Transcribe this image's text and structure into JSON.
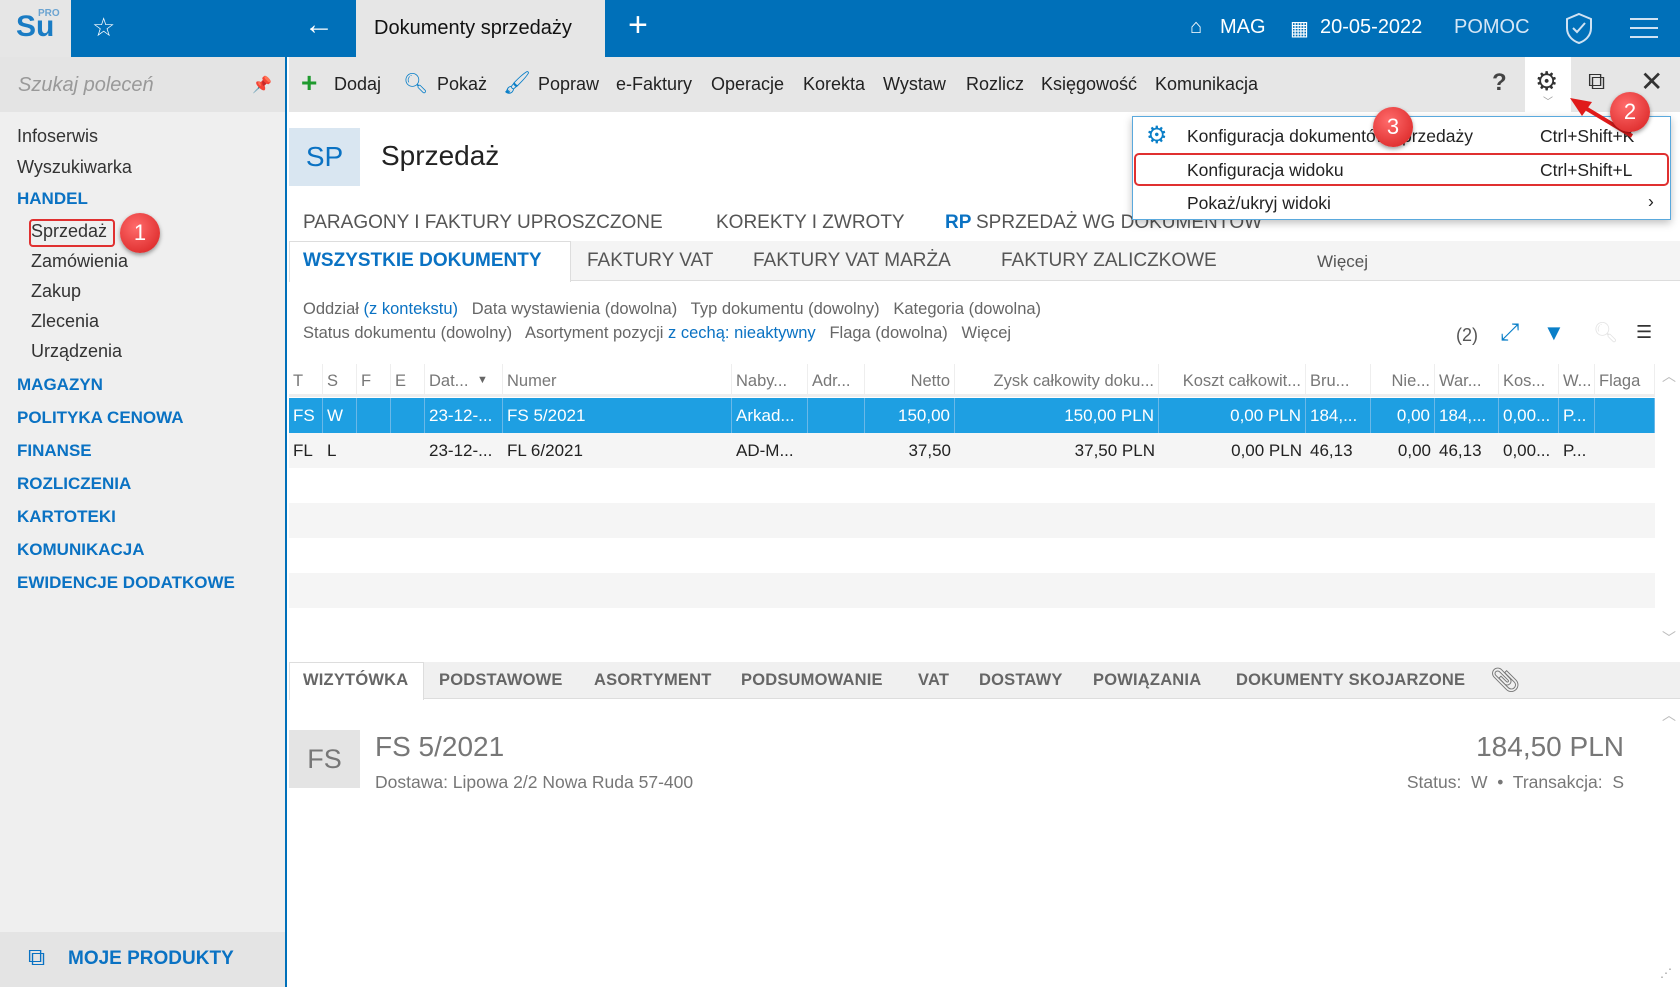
{
  "topbar": {
    "logo": "Su",
    "logo_sup": "PRO",
    "tab_title": "Dokumenty sprzedaży",
    "warehouse": "MAG",
    "date": "20-05-2022",
    "help": "POMOC"
  },
  "sidebar": {
    "search_placeholder": "Szukaj poleceń",
    "items": [
      "Infoserwis",
      "Wyszukiwarka"
    ],
    "handel": "HANDEL",
    "handel_items": [
      "Sprzedaż",
      "Zamówienia",
      "Zakup",
      "Zlecenia",
      "Urządzenia"
    ],
    "sections": [
      "MAGAZYN",
      "POLITYKA CENOWA",
      "FINANSE",
      "ROZLICZENIA",
      "KARTOTEKI",
      "KOMUNIKACJA",
      "EWIDENCJE DODATKOWE"
    ],
    "footer": "MOJE PRODUKTY"
  },
  "toolbar": {
    "items": [
      "Dodaj",
      "Pokaż",
      "Popraw",
      "e-Faktury",
      "Operacje",
      "Korekta",
      "Wystaw",
      "Rozlicz",
      "Księgowość",
      "Komunikacja"
    ],
    "help": "?"
  },
  "header": {
    "code": "SP",
    "title": "Sprzedaż"
  },
  "tabs_top": [
    "PARAGONY I FAKTURY UPROSZCZONE",
    "KOREKTY I ZWROTY",
    "RP",
    "SPRZEDAŻ WG DOKUMENTÓW"
  ],
  "tabs": [
    "WSZYSTKIE DOKUMENTY",
    "FAKTURY VAT",
    "FAKTURY VAT MARŻA",
    "FAKTURY ZALICZKOWE",
    "Więcej"
  ],
  "filters": {
    "oddzial": "Oddział",
    "oddzial_val": "(z kontekstu)",
    "data": "Data wystawienia (dowolna)",
    "typ": "Typ dokumentu (dowolny)",
    "kategoria": "Kategoria (dowolna)",
    "status": "Status dokumentu (dowolny)",
    "asort": "Asortyment pozycji",
    "asort_val": "z cechą: nieaktywny",
    "flaga": "Flaga (dowolna)",
    "wiecej": "Więcej",
    "count": "(2)"
  },
  "grid": {
    "columns": [
      "T",
      "S",
      "F",
      "E",
      "Dat...",
      "Numer",
      "Naby...",
      "Adr...",
      "Netto",
      "Zysk całkowity doku...",
      "Koszt całkowit...",
      "Bru...",
      "Nie...",
      "War...",
      "Kos...",
      "W...",
      "Flaga"
    ],
    "rows": [
      [
        "FS",
        "W",
        "",
        "",
        "23-12-...",
        "FS 5/2021",
        "Arkad...",
        "",
        "150,00",
        "150,00 PLN",
        "0,00 PLN",
        "184,...",
        "0,00",
        "184,...",
        "0,00...",
        "P...",
        ""
      ],
      [
        "FL",
        "L",
        "",
        "",
        "23-12-...",
        "FL 6/2021",
        "AD-M...",
        "",
        "37,50",
        "37,50 PLN",
        "0,00 PLN",
        "46,13",
        "0,00",
        "46,13",
        "0,00...",
        "P...",
        ""
      ]
    ]
  },
  "bottom_tabs": [
    "WIZYTÓWKA",
    "PODSTAWOWE",
    "ASORTYMENT",
    "PODSUMOWANIE",
    "VAT",
    "DOSTAWY",
    "POWIĄZANIA",
    "DOKUMENTY SKOJARZONE"
  ],
  "detail": {
    "type": "FS",
    "number": "FS 5/2021",
    "address": "Dostawa: Lipowa  2/2 Nowa Ruda 57-400",
    "amount": "184,50 PLN",
    "status": "Status:  W  •  Transakcja:  S"
  },
  "menu": {
    "items": [
      {
        "label": "Konfiguracja dokumentów sprzedaży",
        "shortcut": "Ctrl+Shift+K"
      },
      {
        "label": "Konfiguracja widoku",
        "shortcut": "Ctrl+Shift+L"
      },
      {
        "label": "Pokaż/ukryj widoki",
        "shortcut": "›"
      }
    ]
  },
  "badges": [
    "1",
    "2",
    "3"
  ]
}
